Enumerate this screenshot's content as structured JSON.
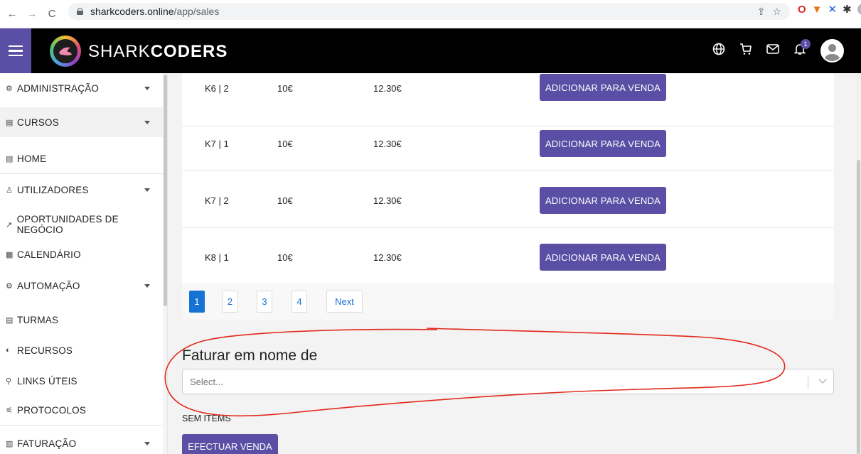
{
  "browser": {
    "url_domain": "sharkcoders.online",
    "url_path": "/app/sales",
    "colors": {
      "toolbar": "#ffffff",
      "omnibox": "#f1f3f4"
    }
  },
  "app": {
    "logo_text_light": "SHARK",
    "logo_text_bold": "CODERS",
    "notification_count": "1",
    "accent_color": "#5b4fa5"
  },
  "sidebar": {
    "items": [
      {
        "icon": "admin-icon",
        "glyph": "⚙",
        "label": "ADMINISTRAÇÃO",
        "has_chevron": true
      },
      {
        "icon": "courses-icon",
        "glyph": "▤",
        "label": "CURSOS",
        "has_chevron": true
      },
      {
        "icon": "home-icon",
        "glyph": "▤",
        "label": "HOME",
        "has_chevron": false
      },
      {
        "icon": "users-icon",
        "glyph": "♙",
        "label": "UTILIZADORES",
        "has_chevron": true
      },
      {
        "icon": "opportunities-icon",
        "glyph": "↗",
        "label": "OPORTUNIDADES DE NEGÓCIO",
        "has_chevron": false
      },
      {
        "icon": "calendar-icon",
        "glyph": "▦",
        "label": "CALENDÁRIO",
        "has_chevron": false
      },
      {
        "icon": "automation-icon",
        "glyph": "⚙",
        "label": "AUTOMAÇÃO",
        "has_chevron": true
      },
      {
        "icon": "classes-icon",
        "glyph": "▤",
        "label": "TURMAS",
        "has_chevron": false
      },
      {
        "icon": "resources-icon",
        "glyph": "◐",
        "label": "RECURSOS",
        "has_chevron": false
      },
      {
        "icon": "links-icon",
        "glyph": "⚲",
        "label": "LINKS ÚTEIS",
        "has_chevron": false
      },
      {
        "icon": "protocols-icon",
        "glyph": "⚟",
        "label": "PROTOCOLOS",
        "has_chevron": false
      },
      {
        "icon": "billing-icon",
        "glyph": "▥",
        "label": "FATURAÇÃO",
        "has_chevron": true
      }
    ]
  },
  "table": {
    "action_label": "ADICIONAR PARA VENDA",
    "rows": [
      {
        "name": "K6 | 2",
        "price": "10€",
        "price_vat": "12.30€"
      },
      {
        "name": "K7 | 1",
        "price": "10€",
        "price_vat": "12.30€"
      },
      {
        "name": "K7 | 2",
        "price": "10€",
        "price_vat": "12.30€"
      },
      {
        "name": "K8 | 1",
        "price": "10€",
        "price_vat": "12.30€"
      }
    ]
  },
  "pagination": {
    "pages": [
      "1",
      "2",
      "3",
      "4"
    ],
    "active_page": "1",
    "next_label": "Next",
    "active_color": "#1672d4"
  },
  "billing": {
    "title": "Faturar em nome de",
    "select_placeholder": "Select...",
    "empty_text": "SEM ITEMS",
    "submit_label": "EFECTUAR VENDA"
  },
  "annotation_color": "#e2281b"
}
